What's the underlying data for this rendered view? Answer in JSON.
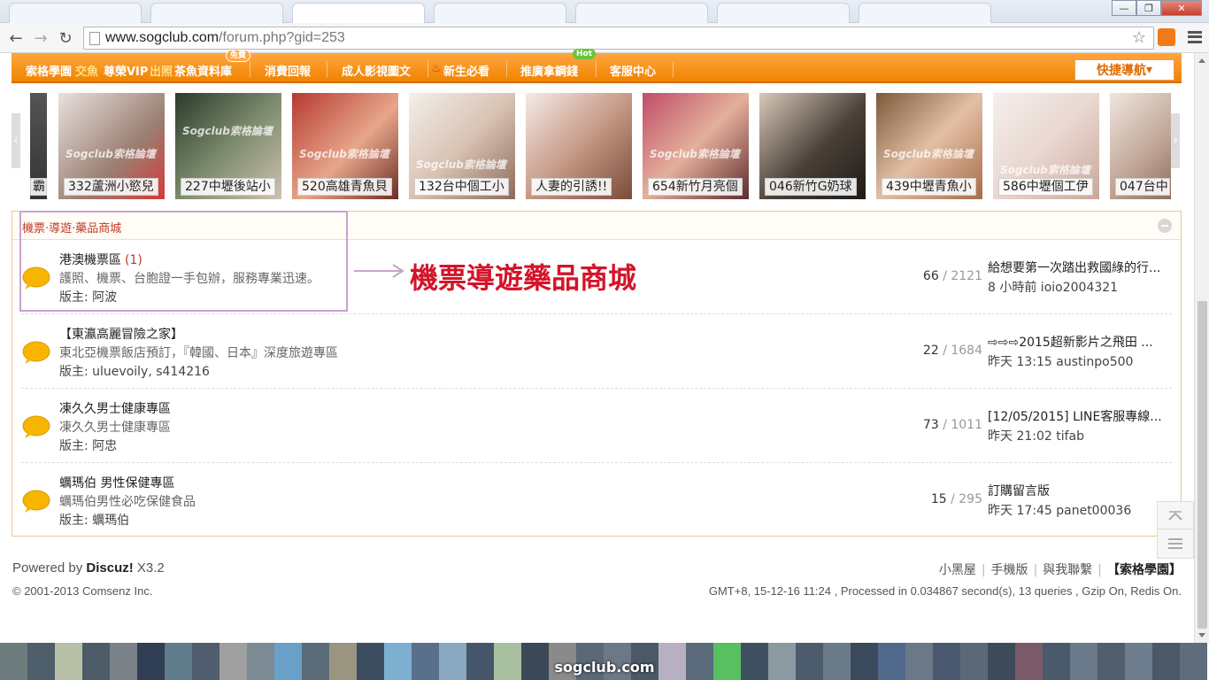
{
  "browser": {
    "url_host": "www.sogclub.com",
    "url_path": "/forum.php?gid=253"
  },
  "site_nav": {
    "items": [
      {
        "label": "索格學園",
        "id": "sog-school"
      },
      {
        "label": "交魚",
        "id": "fish"
      },
      {
        "label": "尊榮VIP",
        "id": "vip"
      },
      {
        "label": "出照",
        "id": "photos"
      },
      {
        "label": "茶魚資料庫",
        "id": "database"
      },
      {
        "label": "消費回報",
        "id": "report"
      },
      {
        "label": "成人影視圖文",
        "id": "adult-media"
      },
      {
        "label": "新生必看",
        "id": "newbie"
      },
      {
        "label": "推廣拿鋼錢",
        "id": "promote"
      },
      {
        "label": "客服中心",
        "id": "support"
      }
    ],
    "badge_free": "免費",
    "badge_hot": "Hot",
    "quick_nav": "快捷導航"
  },
  "gallery": [
    {
      "caption": "霸"
    },
    {
      "caption": "332蘆洲小慾兒"
    },
    {
      "caption": "227中壢後站小"
    },
    {
      "caption": "520高雄青魚貝"
    },
    {
      "caption": "132台中個工小"
    },
    {
      "caption": "人妻的引誘!!"
    },
    {
      "caption": "654新竹月亮個"
    },
    {
      "caption": "046新竹G奶球"
    },
    {
      "caption": "439中壢青魚小"
    },
    {
      "caption": "586中壢個工伊"
    },
    {
      "caption": "047台中"
    }
  ],
  "gallery_watermark": "Sogclub索格論壇",
  "category": {
    "title": "機票·導遊·藥品商城",
    "forums": [
      {
        "name": "港澳機票區",
        "today": "(1)",
        "desc": "護照、機票、台胞證一手包辦，服務專業迅速。",
        "moderator": "版主: 阿波",
        "threads": "66",
        "posts": "/ 2121",
        "last_title": "給想要第一次踏出救國綠的行...",
        "last_meta": "8 小時前 ioio2004321"
      },
      {
        "name": "【東瀛高麗冒險之家】",
        "today": "",
        "desc": "東北亞機票飯店預訂，『韓國、日本』深度旅遊專區",
        "moderator": "版主: uluevoily, s414216",
        "threads": "22",
        "posts": "/ 1684",
        "last_title": "⇨⇨⇨2015超新影片之飛田 ...",
        "last_meta": "昨天 13:15 austinpo500"
      },
      {
        "name": "凍久久男士健康專區",
        "today": "",
        "desc": "凍久久男士健康專區",
        "moderator": "版主: 阿忠",
        "threads": "73",
        "posts": "/ 1011",
        "last_title": "[12/05/2015] LINE客服專線...",
        "last_meta": "昨天 21:02 tifab"
      },
      {
        "name": "蠣瑪伯 男性保健專區",
        "today": "",
        "desc": "蠣瑪伯男性必吃保健食品",
        "moderator": "版主: 蠣瑪伯",
        "threads": "15",
        "posts": "/ 295",
        "last_title": "訂購留言版",
        "last_meta": "昨天 17:45 panet00036"
      }
    ]
  },
  "annotation": {
    "text": "機票導遊藥品商城",
    "color": "#d4142a"
  },
  "footer": {
    "powered_prefix": "Powered by ",
    "powered_brand": "Discuz!",
    "powered_version": " X3.2",
    "copyright": "© 2001-2013 Comsenz Inc.",
    "links": [
      "小黑屋",
      "手機版",
      "與我聯繫",
      "【索格學園】"
    ],
    "info": "GMT+8, 15-12-16 11:24 , Processed in 0.034867 second(s), 13 queries , Gzip On, Redis On."
  },
  "taskbar": {
    "label": "sogclub.com"
  },
  "colors": {
    "nav_orange": "#f08400",
    "category_border": "#e7c98c",
    "bubble_yellow": "#f7b500"
  }
}
